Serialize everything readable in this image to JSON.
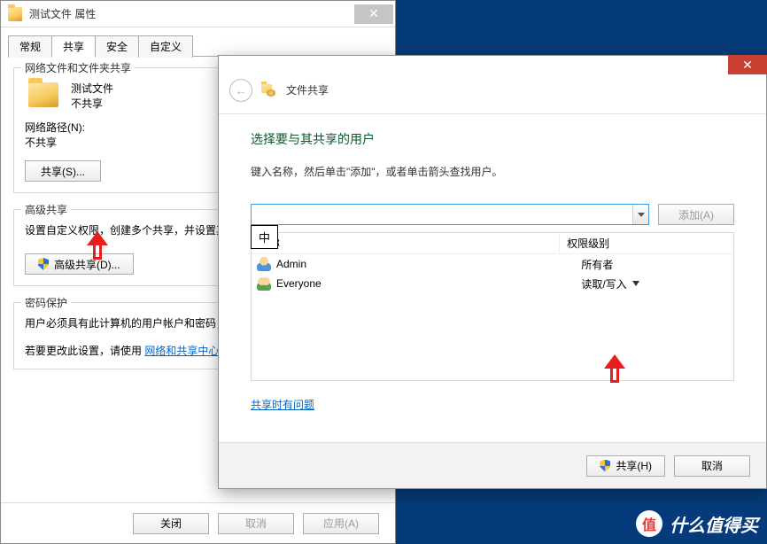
{
  "props": {
    "title": "测试文件 属性",
    "tabs": [
      "常规",
      "共享",
      "安全",
      "自定义"
    ],
    "active_tab": 1,
    "group_share": {
      "legend": "网络文件和文件夹共享",
      "item_name": "测试文件",
      "item_status": "不共享",
      "path_label": "网络路径(N):",
      "path_value": "不共享",
      "share_btn": "共享(S)..."
    },
    "group_adv": {
      "legend": "高级共享",
      "desc": "设置自定义权限，创建多个共享，并设置其他高级共享选项。",
      "adv_btn": "高级共享(D)..."
    },
    "group_pass": {
      "legend": "密码保护",
      "line1": "用户必须具有此计算机的用户帐户和密码，才能访问共享文件夹。",
      "line2_prefix": "若要更改此设置，请使用",
      "line2_link": "网络和共享中心"
    },
    "footer": {
      "close": "关闭",
      "cancel": "取消",
      "apply": "应用(A)"
    }
  },
  "wizard": {
    "title": "文件共享",
    "heading": "选择要与其共享的用户",
    "sub": "键入名称，然后单击\"添加\"，或者单击箭头查找用户。",
    "add_btn": "添加(A)",
    "ime": "中",
    "columns": {
      "name": "名称",
      "perm": "权限级别"
    },
    "rows": [
      {
        "name": "Admin",
        "perm": "所有者",
        "icon": "single",
        "dropdown": false
      },
      {
        "name": "Everyone",
        "perm": "读取/写入",
        "icon": "group",
        "dropdown": true
      }
    ],
    "help_link": "共享时有问题",
    "share_btn": "共享(H)",
    "cancel_btn": "取消"
  },
  "brand": {
    "badge": "值",
    "text": "什么值得买"
  }
}
